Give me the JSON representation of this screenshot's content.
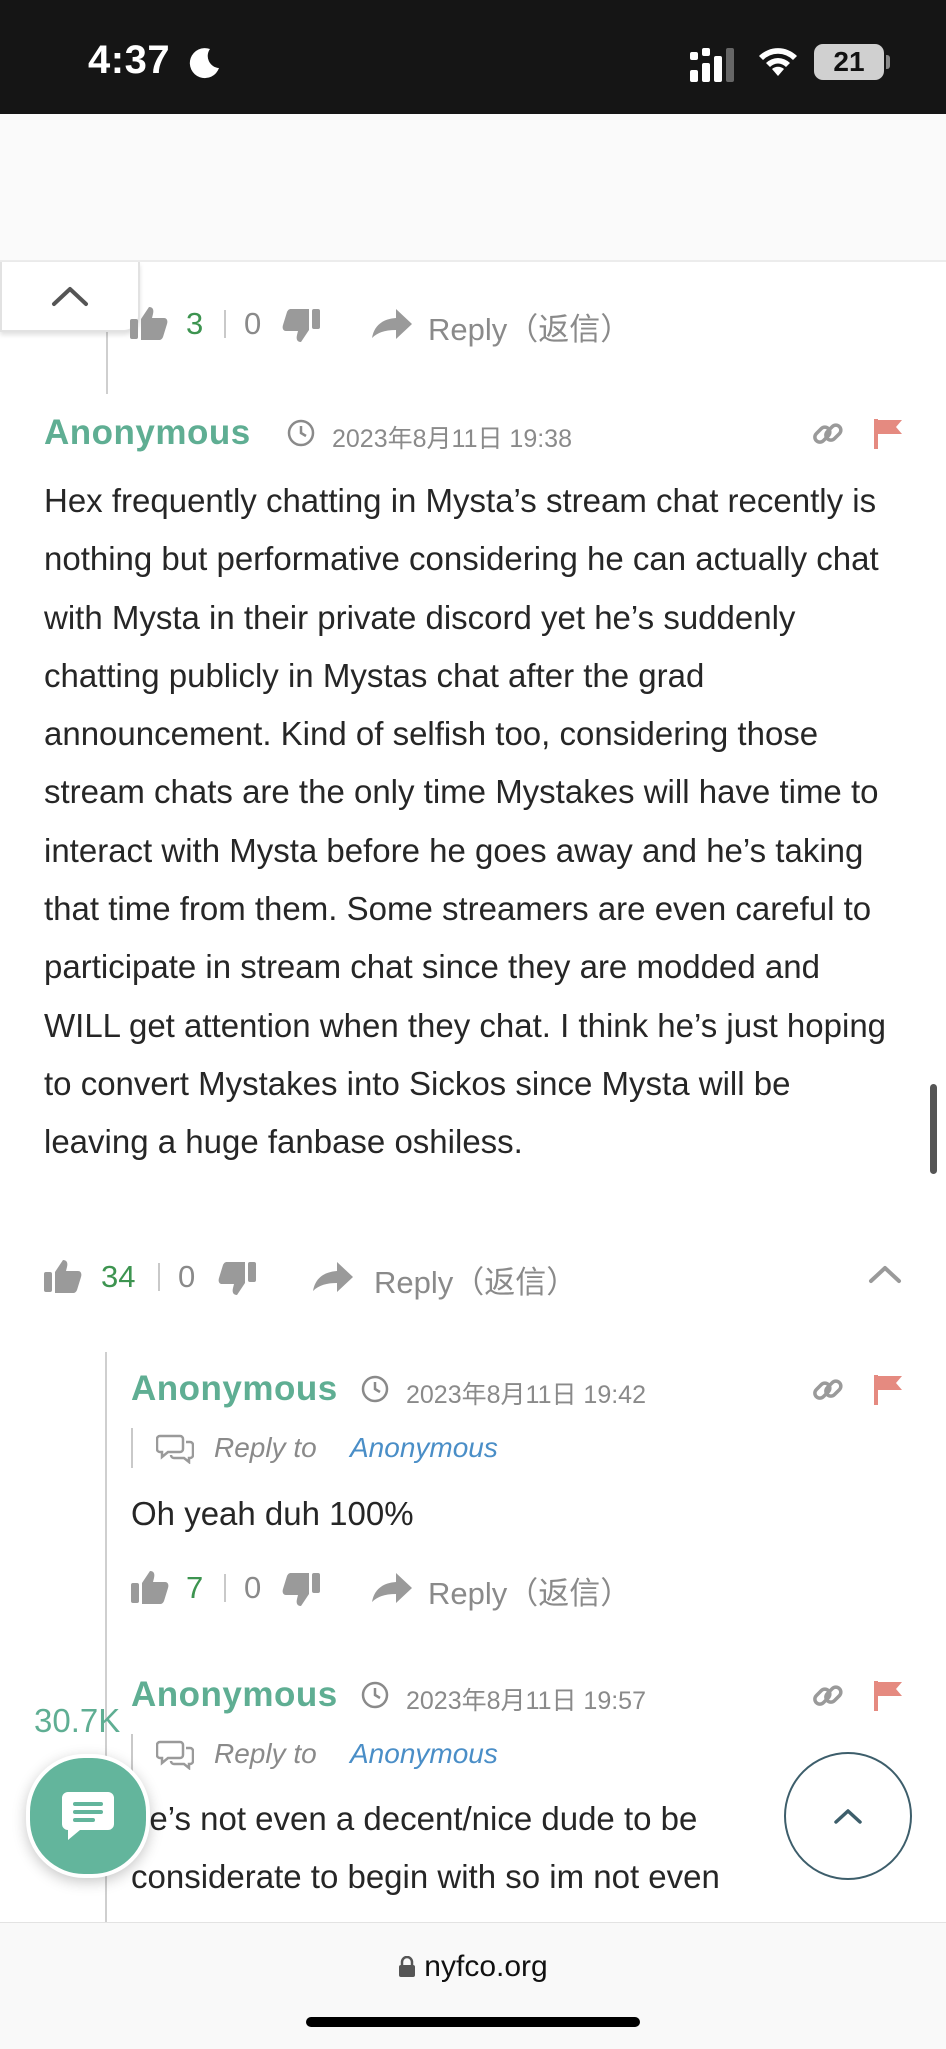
{
  "status": {
    "time": "4:37",
    "battery": "21"
  },
  "browser": {
    "url": "nyfco.org"
  },
  "counter": "30.7K",
  "comments": {
    "top": {
      "likes": "3",
      "dislikes": "0",
      "reply_label": "Reply（返信）"
    },
    "c1": {
      "author": "Anonymous",
      "date": "2023年8月11日 19:38",
      "text": "Hex frequently chatting in Mysta’s stream chat recently is nothing but performative considering he can actually chat with Mysta in their private discord yet he’s suddenly chatting publicly in Mystas chat after the grad announcement. Kind of selfish too, considering those stream chats are the only time Mystakes will have time to interact with Mysta before he goes away and he’s taking that time from them. Some streamers are even careful to participate in stream chat since they are modded and WILL get attention when they chat. I think he’s just hoping to convert Mystakes into Sickos since Mysta will be leaving a huge fanbase oshiless.",
      "likes": "34",
      "dislikes": "0",
      "reply_label": "Reply（返信）"
    },
    "c2": {
      "author": "Anonymous",
      "date": "2023年8月11日 19:42",
      "reply_to_label": "Reply to",
      "reply_to_name": "Anonymous",
      "text": "Oh yeah duh 100%",
      "likes": "7",
      "dislikes": "0",
      "reply_label": "Reply（返信）"
    },
    "c3": {
      "author": "Anonymous",
      "date": "2023年8月11日 19:57",
      "reply_to_label": "Reply to",
      "reply_to_name": "Anonymous",
      "text": "he’s not even a decent/nice dude to be considerate to begin with so im not even"
    }
  },
  "colors": {
    "accent": "#5fae93",
    "like": "#3d9450",
    "flag": "#e58a80",
    "link": "#4a8ec7",
    "icon": "#9a9a9a"
  }
}
